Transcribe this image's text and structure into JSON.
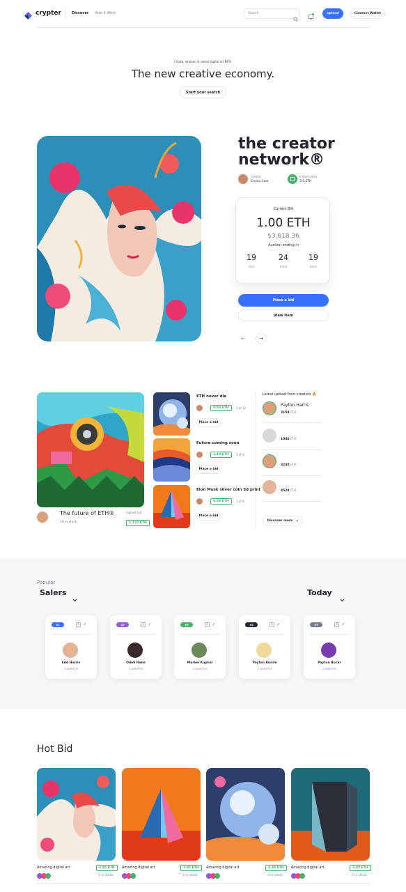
{
  "header": {
    "brand": "crypter",
    "nav": [
      "Discover",
      "How it Work"
    ],
    "search_placeholder": "Search",
    "upload_label": "upload",
    "connect_label": "Connect Wallet"
  },
  "hero": {
    "subtitle": "Create, explore, & collect digital art NFTs.",
    "title": "The new creative economy.",
    "cta": "Start your search"
  },
  "feature": {
    "title_line1": "the creator",
    "title_line2": "network®",
    "creator_label": "Creator",
    "creator_name": "Enrico Cole",
    "price_label": "Instant price",
    "price_value": "3.5 ETH",
    "bid_label": "Current Bid",
    "bid_eth": "1.00 ETH",
    "bid_usd": "$3,618.36",
    "auction_label": "Auction ending in",
    "timer": [
      {
        "value": "19",
        "unit": "Hrs"
      },
      {
        "value": "24",
        "unit": "mins"
      },
      {
        "value": "19",
        "unit": "secs"
      }
    ],
    "place_bid": "Place a bid",
    "view_item": "View item",
    "prev_arrow": "←",
    "next_arrow": "→"
  },
  "collection": {
    "main_title": "The future of ETH®",
    "main_stock": "18 in stock",
    "main_bid_label": "highest bid",
    "main_bid_value": "1.125 ETH",
    "items": [
      {
        "title": "ETH never die",
        "price": "0.58 ETH",
        "count": "1 of 12",
        "button": "Place a bid"
      },
      {
        "title": "Future coming soon",
        "price": "1.10 ETH",
        "count": "1 of 3",
        "button": "Place a bid"
      },
      {
        "title": "Elon Musk silver coin 3d print",
        "price": "0.59 ETH",
        "count": "1 of 4",
        "button": "Place a bid"
      }
    ],
    "latest_title": "Latest upload from creators 🔥",
    "creators": [
      {
        "name": "Payton Harris",
        "amount": "3158",
        "unit": "ETH"
      },
      {
        "name": "",
        "amount": "1046",
        "unit": "ETH"
      },
      {
        "name": "",
        "amount": "3248",
        "unit": "ETH"
      },
      {
        "name": "",
        "amount": "4528",
        "unit": "ETH"
      }
    ],
    "discover_more": "Discover more"
  },
  "popular": {
    "label": "Popular",
    "title": "Salers",
    "period": "Today",
    "sellers": [
      {
        "rank": "#1",
        "name": "Edd Harris",
        "amount": "2.456 ETH",
        "badge_color": "#3772FF"
      },
      {
        "rank": "#2",
        "name": "Odell Hane",
        "amount": "2.456 ETH",
        "badge_color": "#9757D7"
      },
      {
        "rank": "#3",
        "name": "Marlee Kuphal",
        "amount": "2.456 ETH",
        "badge_color": "#45B26B"
      },
      {
        "rank": "#4",
        "name": "Payton Kunde",
        "amount": "2.456 ETH",
        "badge_color": "#23262F"
      },
      {
        "rank": "#5",
        "name": "Payton Buckr",
        "amount": "2.456 ETH",
        "badge_color": "#777E90"
      }
    ]
  },
  "hotbid": {
    "title": "Hot Bid",
    "items": [
      {
        "name": "Amazing digital art",
        "price": "2.45 ETH",
        "stock": "3 in stock"
      },
      {
        "name": "Amazing digital art",
        "price": "2.45 ETH",
        "stock": "3 in stock"
      },
      {
        "name": "Amazing digital art",
        "price": "2.45 ETH",
        "stock": "3 in stock"
      },
      {
        "name": "Amazing digital art",
        "price": "2.45 ETH",
        "stock": "3 in stock"
      }
    ]
  }
}
